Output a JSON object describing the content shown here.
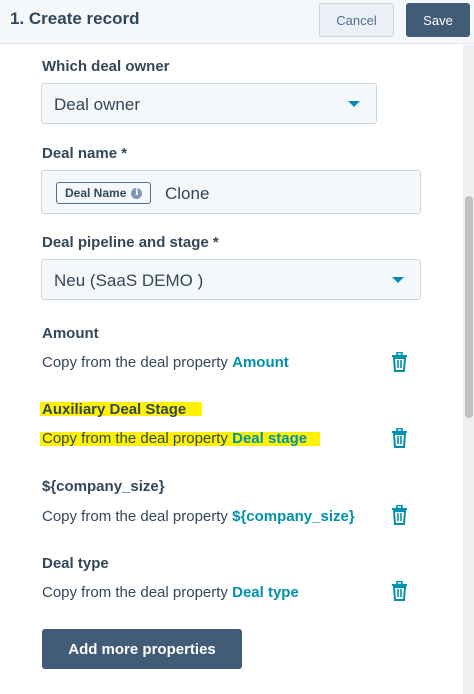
{
  "header": {
    "title": "1. Create record",
    "cancel_label": "Cancel",
    "save_label": "Save"
  },
  "fields": {
    "deal_owner": {
      "label": "Which deal owner",
      "value": "Deal owner"
    },
    "deal_name": {
      "label": "Deal name *",
      "token_label": "Deal Name",
      "suffix_text": "Clone"
    },
    "pipeline": {
      "label": "Deal pipeline and stage *",
      "value": "Neu (SaaS DEMO )"
    }
  },
  "properties": [
    {
      "label": "Amount",
      "copy_prefix": "Copy from the deal property",
      "source": "Amount",
      "highlighted": false
    },
    {
      "label": "Auxiliary Deal Stage",
      "copy_prefix": "Copy from the deal property",
      "source": "Deal stage",
      "highlighted": true
    },
    {
      "label": "${company_size}",
      "copy_prefix": "Copy from the deal property",
      "source": "${company_size}",
      "highlighted": false
    },
    {
      "label": "Deal type",
      "copy_prefix": "Copy from the deal property",
      "source": "Deal type",
      "highlighted": false
    }
  ],
  "add_more_label": "Add more properties",
  "icons": {
    "delete": "trash-icon",
    "info": "info-icon",
    "dropdown": "caret-down-icon"
  },
  "colors": {
    "accent": "#0091ae",
    "primary_button": "#425b76",
    "highlight": "#fff200"
  }
}
